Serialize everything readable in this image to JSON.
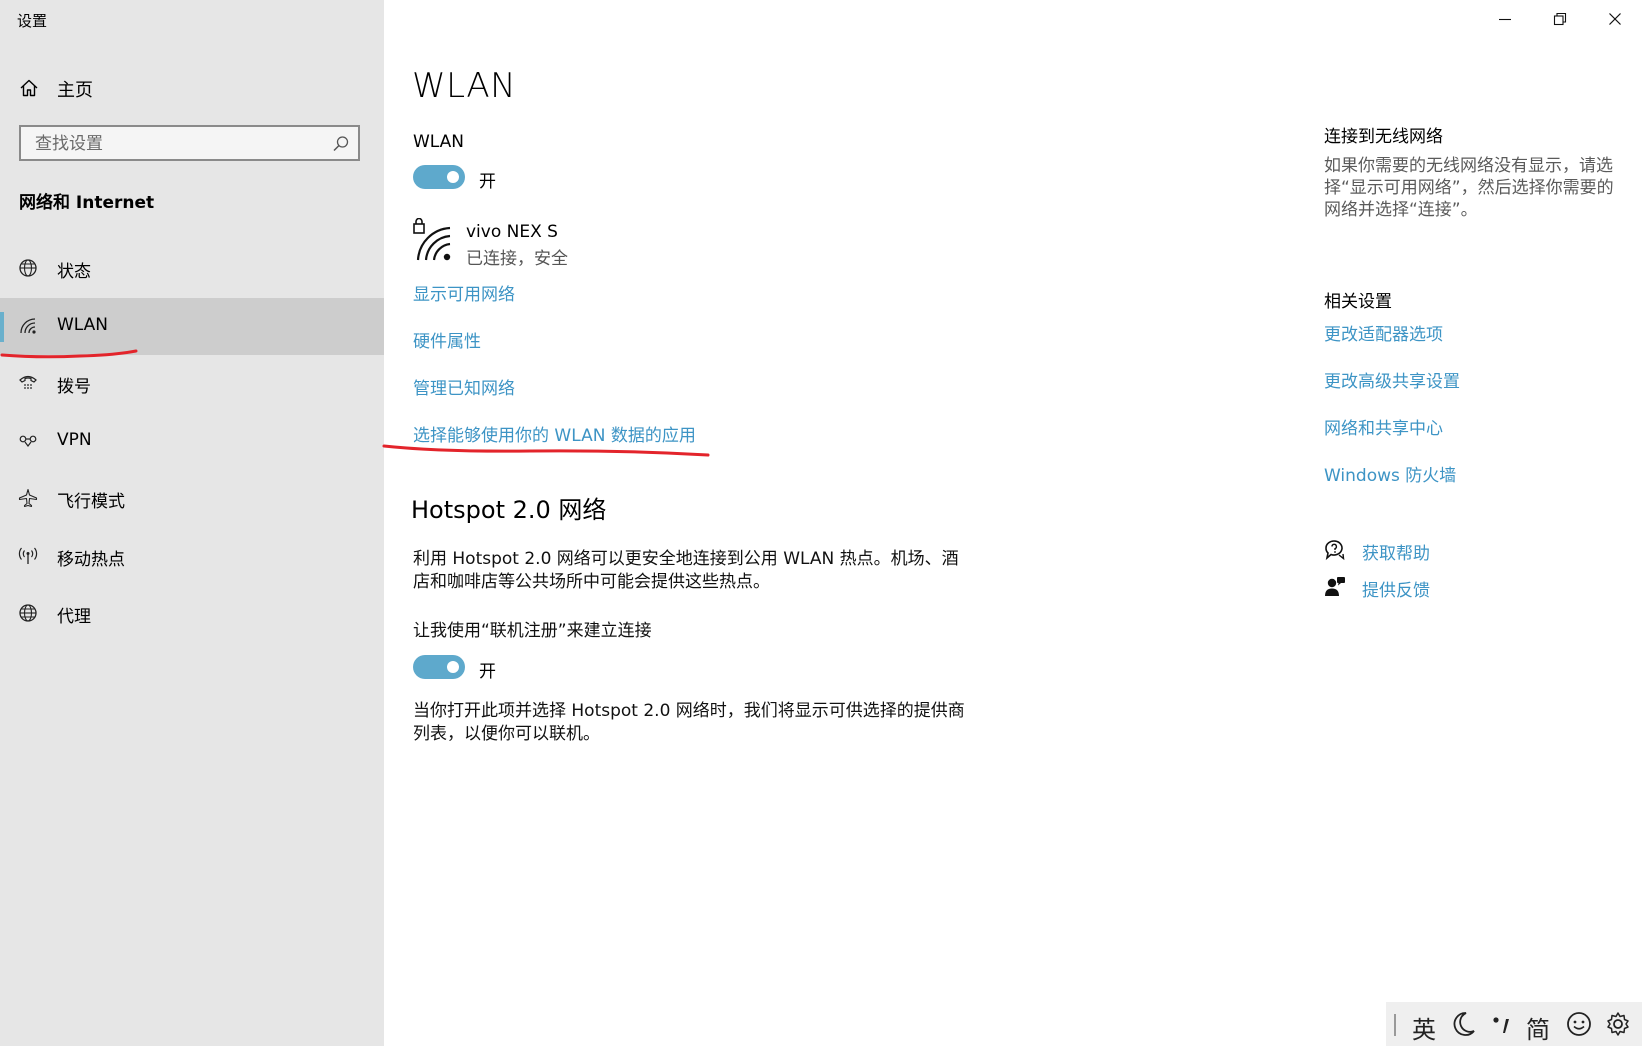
{
  "window": {
    "title": "设置",
    "controls": [
      "minimize-icon",
      "restore-icon",
      "close-icon"
    ]
  },
  "sidebar": {
    "home_label": "主页",
    "search": {
      "placeholder": "查找设置",
      "value": ""
    },
    "section_title": "网络和 Internet",
    "items": [
      {
        "label": "状态",
        "icon": "globe-status-icon"
      },
      {
        "label": "WLAN",
        "icon": "wifi-icon",
        "active": true
      },
      {
        "label": "拨号",
        "icon": "dialup-icon"
      },
      {
        "label": "VPN",
        "icon": "vpn-icon"
      },
      {
        "label": "飞行模式",
        "icon": "airplane-icon"
      },
      {
        "label": "移动热点",
        "icon": "hotspot-icon"
      },
      {
        "label": "代理",
        "icon": "globe-icon"
      }
    ]
  },
  "main": {
    "title": "WLAN",
    "wlan_label": "WLAN",
    "wlan_toggle": {
      "on": true,
      "state_label": "开"
    },
    "network": {
      "name": "vivo NEX S",
      "status": "已连接，安全"
    },
    "links": [
      "显示可用网络",
      "硬件属性",
      "管理已知网络",
      "选择能够使用你的 WLAN 数据的应用"
    ],
    "hotspot": {
      "title": "Hotspot 2.0 网络",
      "description_line1": "利用 Hotspot 2.0 网络可以更安全地连接到公用 WLAN 热点。机场、酒",
      "description_line2": "店和咖啡店等公共场所中可能会提供这些热点。",
      "option_label": "让我使用“联机注册”来建立连接",
      "toggle": {
        "on": true,
        "state_label": "开"
      },
      "note_line1": "当你打开此项并选择 Hotspot 2.0 网络时，我们将显示可供选择的提供商",
      "note_line2": "列表，以便你可以联机。"
    }
  },
  "right": {
    "connect_title": "连接到无线网络",
    "connect_line1": "如果你需要的无线网络没有显示，请选",
    "connect_line2": "择“显示可用网络”，然后选择你需要的",
    "connect_line3": "网络并选择“连接”。",
    "related_title": "相关设置",
    "related_links": [
      "更改适配器选项",
      "更改高级共享设置",
      "网络和共享中心",
      "Windows 防火墙"
    ],
    "help": [
      {
        "label": "获取帮助",
        "icon": "help-chat-icon"
      },
      {
        "label": "提供反馈",
        "icon": "feedback-person-icon"
      }
    ]
  },
  "ime_tray": {
    "lang": "英",
    "mode": "简",
    "icons": [
      "moon-icon",
      "punctuation-icon",
      "emoji-icon",
      "settings-gear-icon"
    ]
  },
  "colors": {
    "accent": "#3d94c5",
    "toggle_on": "#5ea9cc",
    "sidebar_bg": "#e6e6e6",
    "sidebar_active": "#cdcdcd",
    "annotation_red": "#e3242b"
  }
}
